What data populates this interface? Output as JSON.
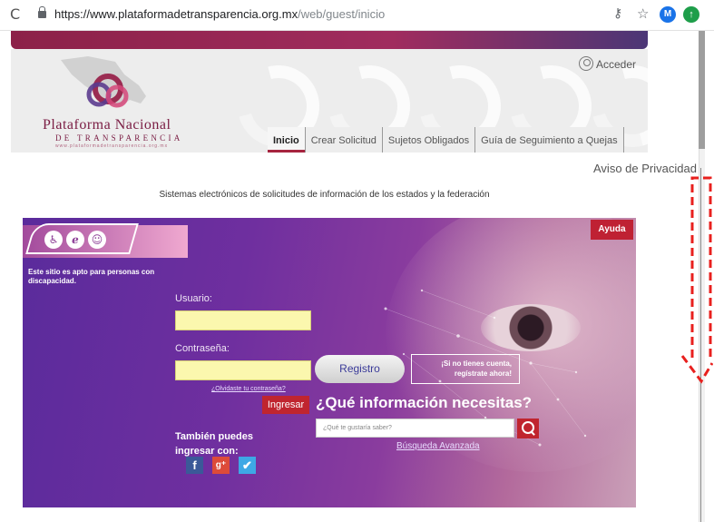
{
  "browser": {
    "url_host": "https://www.plataformadetransparencia.org.mx",
    "url_path": "/web/guest/inicio",
    "reload_icon": "reload-icon",
    "avatar_letter": "M"
  },
  "header": {
    "logo_line1": "Plataforma Nacional",
    "logo_line2": "DE TRANSPARENCIA",
    "logo_line3": "www.plataformadetransparencia.org.mx",
    "acceder": "Acceder"
  },
  "nav": {
    "tabs": [
      {
        "label": "Inicio"
      },
      {
        "label": "Crear Solicitud"
      },
      {
        "label": "Sujetos Obligados"
      },
      {
        "label": "Guía de Seguimiento a Quejas"
      }
    ]
  },
  "aviso": "Aviso de Privacidad",
  "subtitle": "Sistemas electrónicos de solicitudes de información de los estados y la federación",
  "hero": {
    "apto": "Este sitio es apto para personas con discapacidad.",
    "ayuda": "Ayuda",
    "usuario_label": "Usuario:",
    "contrasena_label": "Contraseña:",
    "olvidaste": "¿Olvidaste tu contraseña?",
    "ingresar": "Ingresar",
    "registro": "Registro",
    "notiene_line1": "¡Si no tienes cuenta,",
    "notiene_line2": "regístrate ahora!",
    "tambien": "También puedes ingresar con:",
    "que_info": "¿Qué información necesitas?",
    "search_placeholder": "¿Qué te gustaría saber?",
    "busqueda": "Búsqueda Avanzada"
  },
  "colors": {
    "brand": "#7a1c43",
    "accent_red": "#c0252f",
    "hero_purple": "#6f2f9f",
    "field_yellow": "#fbf7ae",
    "annotation": "#e8201e"
  }
}
